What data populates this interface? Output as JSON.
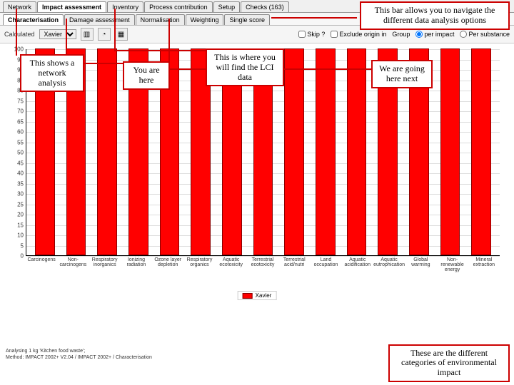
{
  "tabs": {
    "row1": [
      "Network",
      "Impact assessment",
      "Inventory",
      "Process contribution",
      "Setup",
      "Checks (163)"
    ],
    "row2": [
      "Characterisation",
      "Damage assessment",
      "Normalisation",
      "Weighting",
      "Single score"
    ],
    "active1": 1,
    "active2": 0
  },
  "toolbar": {
    "label_calc": "Calculated",
    "select_calc": "Xavier",
    "icons": [
      "chart-bar-icon",
      "chart-pie-icon",
      "table-icon"
    ],
    "check1": "Skip ?",
    "check2": "Exclude origin in",
    "radio_group": "Group",
    "per1": "per impact",
    "per2": "Per substance"
  },
  "chart_data": {
    "type": "bar",
    "ylabel": "%",
    "ylim": [
      0,
      100
    ],
    "yticks": [
      0,
      5,
      10,
      15,
      20,
      25,
      30,
      35,
      40,
      45,
      50,
      55,
      60,
      65,
      70,
      75,
      80,
      85,
      90,
      95,
      100
    ],
    "categories": [
      "Carcinogens",
      "Non-carcinogens",
      "Respiratory inorganics",
      "Ionizing radiation",
      "Ozone layer depletion",
      "Respiratory organics",
      "Aquatic ecotoxicity",
      "Terrestrial ecotoxicity",
      "Terrestrial acid/nutri",
      "Land occupation",
      "Aquatic acidification",
      "Aquatic eutrophication",
      "Global warming",
      "Non-renewable energy",
      "Mineral extraction"
    ],
    "series": [
      {
        "name": "Xavier",
        "color": "#ff0000",
        "values": [
          100,
          100,
          100,
          100,
          100,
          100,
          100,
          100,
          100,
          100,
          100,
          100,
          100,
          100,
          100
        ]
      }
    ]
  },
  "legend_label": "Xavier",
  "footer": {
    "line1": "Analysing 1 kg 'Kitchen food waste';",
    "line2": "Method: IMPACT 2002+ V2.04 / IMPACT 2002+ / Characterisation"
  },
  "annotations": {
    "navbar": "This bar allows you to navigate the different data analysis options",
    "network": "This shows a network analysis",
    "here": "You are here",
    "lci": "This is where you will find the LCI data",
    "next": "We are going here next",
    "categories": "These are the different categories of environmental impact"
  }
}
